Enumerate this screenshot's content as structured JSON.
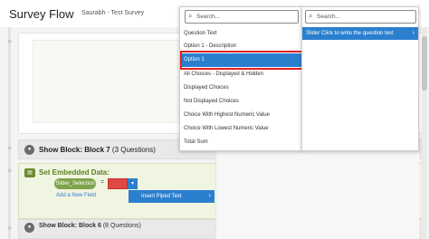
{
  "header": {
    "title": "Survey Flow",
    "subtitle": "Saurabh - Test Survey"
  },
  "blocks": {
    "show_block_7": {
      "label": "Show Block: Block 7",
      "count": "(3 Questions)"
    },
    "embedded": {
      "title": "Set Embedded Data:",
      "field_name": "Slider_Selection",
      "equals": "=",
      "add_field": "Add a New Field",
      "insert_piped": "Insert Piped Text"
    },
    "show_block_6": {
      "label": "Show Block: Block 6",
      "count": "(8 Questions)"
    }
  },
  "left_panel": {
    "search_placeholder": "Search...",
    "items": [
      "Question Text",
      "Option 1 - Description",
      "Option 1",
      "All Choices - Displayed & Hidden",
      "Displayed Choices",
      "Not Displayed Choices",
      "Choice With Highest Numeric Value",
      "Choice With Lowest Numeric Value",
      "Total Sum"
    ],
    "selected_index": 2
  },
  "right_panel": {
    "search_placeholder": "Search...",
    "selected_item": "Slider Click to write the question text"
  },
  "colors": {
    "accent": "#2b7fcf",
    "highlight": "#e02020",
    "embed_green": "#6b8c2e"
  }
}
